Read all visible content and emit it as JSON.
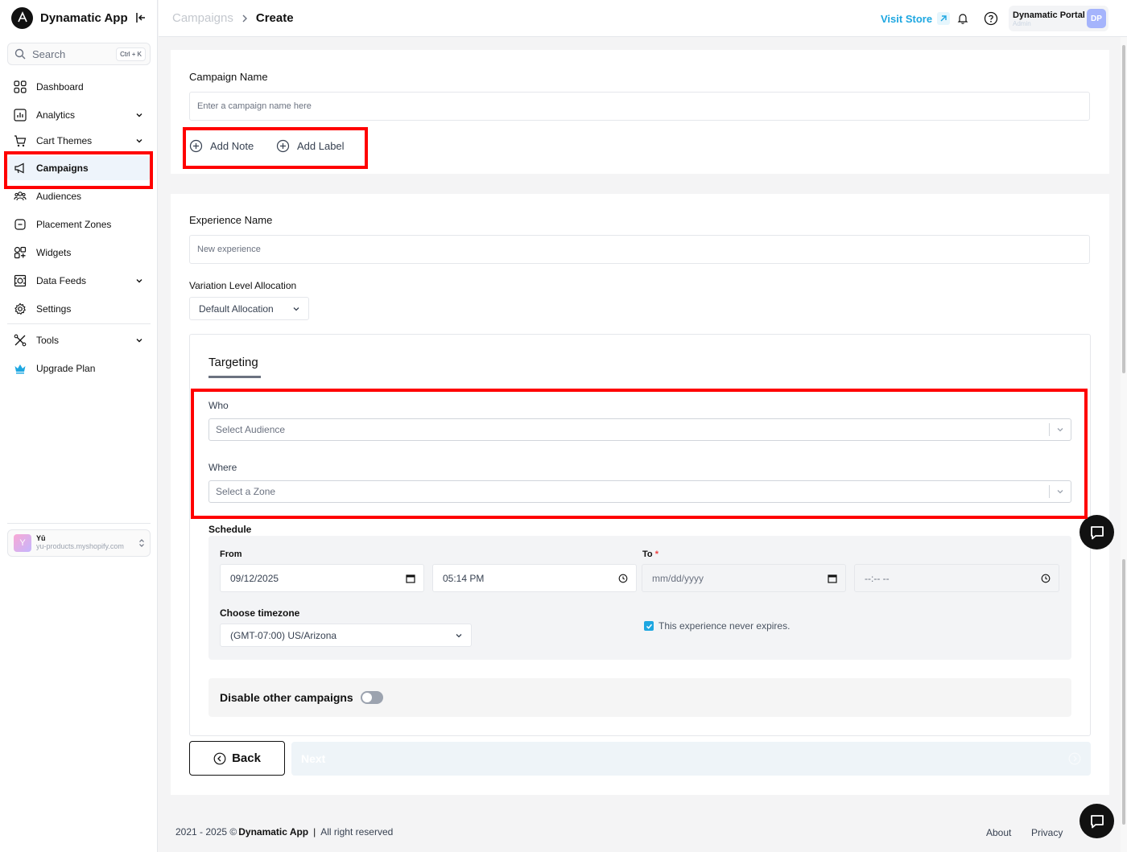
{
  "app": {
    "name": "Dynamatic App"
  },
  "search": {
    "placeholder": "Search",
    "shortcut": "Ctrl + K"
  },
  "sidebar": {
    "items": [
      {
        "label": "Dashboard",
        "icon": "grid-icon"
      },
      {
        "label": "Analytics",
        "icon": "bar-chart-icon",
        "has_submenu": true
      },
      {
        "label": "Cart Themes",
        "icon": "cart-icon",
        "has_submenu": true
      },
      {
        "label": "Campaigns",
        "icon": "megaphone-icon",
        "active": true
      },
      {
        "label": "Audiences",
        "icon": "users-icon"
      },
      {
        "label": "Placement Zones",
        "icon": "zone-icon"
      },
      {
        "label": "Widgets",
        "icon": "widgets-icon"
      },
      {
        "label": "Data Feeds",
        "icon": "data-feed-icon",
        "has_submenu": true
      },
      {
        "label": "Settings",
        "icon": "gear-icon"
      },
      {
        "label": "Tools",
        "icon": "tools-icon",
        "has_submenu": true
      },
      {
        "label": "Upgrade Plan",
        "icon": "crown-icon"
      }
    ],
    "store": {
      "initial": "Y",
      "name": "Yū",
      "domain": "yu-products.myshopify.com"
    }
  },
  "header": {
    "breadcrumb_parent": "Campaigns",
    "breadcrumb_current": "Create",
    "visit_store": "Visit Store",
    "portal_name": "Dynamatic Portal",
    "portal_role": "Admin",
    "portal_initials": "DP"
  },
  "campaign": {
    "name_label": "Campaign Name",
    "name_placeholder": "Enter a campaign name here",
    "add_note": "Add Note",
    "add_label": "Add Label"
  },
  "experience": {
    "name_label": "Experience Name",
    "name_placeholder": "New experience",
    "allocation_label": "Variation Level Allocation",
    "allocation_value": "Default Allocation"
  },
  "targeting": {
    "tab_label": "Targeting",
    "who_label": "Who",
    "who_placeholder": "Select Audience",
    "where_label": "Where",
    "where_placeholder": "Select a Zone"
  },
  "schedule": {
    "title": "Schedule",
    "from_label": "From",
    "from_date": "09/12/2025",
    "from_time": "05:14 PM",
    "to_label": "To",
    "to_required": "*",
    "to_date": "mm/dd/yyyy",
    "to_time": "--:-- --",
    "timezone_label": "Choose timezone",
    "timezone_value": "(GMT-07:00) US/Arizona",
    "never_expires": "This experience never expires."
  },
  "disable_campaigns": {
    "label": "Disable other campaigns",
    "enabled": false
  },
  "actions": {
    "back": "Back",
    "next": "Next"
  },
  "footer": {
    "years": "2021 - 2025 ©",
    "brand": "Dynamatic App",
    "rights": "All right reserved",
    "about": "About",
    "privacy": "Privacy"
  },
  "colors": {
    "accent": "#1ea7e1",
    "highlight": "#ff0000"
  }
}
